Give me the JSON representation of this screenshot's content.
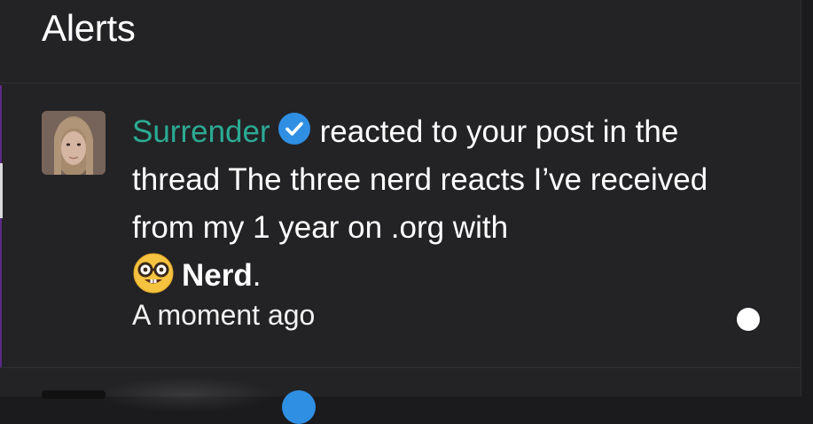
{
  "header": {
    "title": "Alerts"
  },
  "alert": {
    "username": "Surrender",
    "action_text": "reacted to your post in the thread The three nerd reacts I’ve received from my 1 year on .org with",
    "reaction_name": "Nerd",
    "trailing_punct": ".",
    "timestamp": "A moment ago",
    "avatar_icon": "user-avatar",
    "verified_icon": "verified-badge-icon",
    "reaction_icon": "nerd-face-emoji",
    "colors": {
      "username": "#2bab93",
      "verified": "#2f8fe3",
      "unread_dot": "#ffffff"
    }
  },
  "theme": {
    "background": "#232325",
    "accent_rule": "#5b2a86"
  }
}
